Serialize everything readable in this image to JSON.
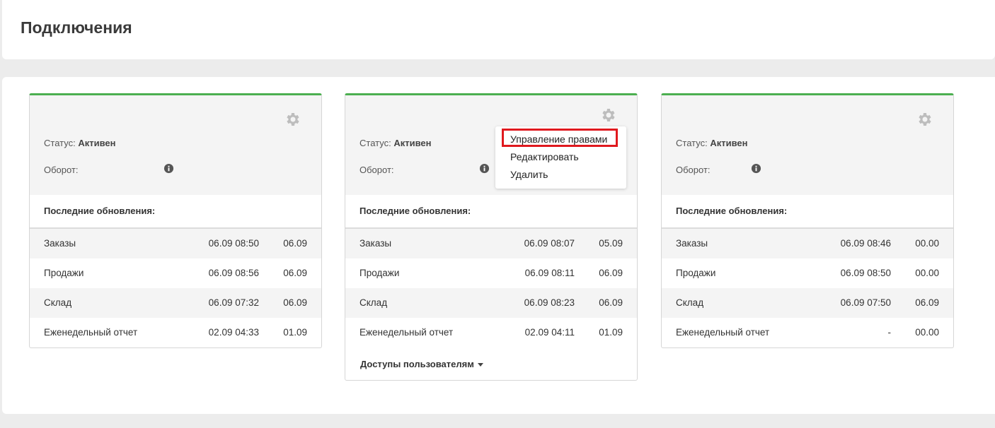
{
  "page": {
    "title": "Подключения"
  },
  "labels": {
    "status_prefix": "Статус:",
    "turnover": "Оборот:",
    "updates_title": "Последние обновления:"
  },
  "cards": [
    {
      "status": "Активен",
      "rows": [
        {
          "name": "Заказы",
          "date1": "06.09 08:50",
          "date2": "06.09"
        },
        {
          "name": "Продажи",
          "date1": "06.09 08:56",
          "date2": "06.09"
        },
        {
          "name": "Склад",
          "date1": "06.09 07:32",
          "date2": "06.09"
        },
        {
          "name": "Еженедельный отчет",
          "date1": "02.09 04:33",
          "date2": "01.09"
        }
      ]
    },
    {
      "status": "Активен",
      "rows": [
        {
          "name": "Заказы",
          "date1": "06.09 08:07",
          "date2": "05.09"
        },
        {
          "name": "Продажи",
          "date1": "06.09 08:11",
          "date2": "06.09"
        },
        {
          "name": "Склад",
          "date1": "06.09 08:23",
          "date2": "06.09"
        },
        {
          "name": "Еженедельный отчет",
          "date1": "02.09 04:11",
          "date2": "01.09"
        }
      ],
      "access_label": "Доступы пользователям"
    },
    {
      "status": "Активен",
      "rows": [
        {
          "name": "Заказы",
          "date1": "06.09 08:46",
          "date2": "00.00"
        },
        {
          "name": "Продажи",
          "date1": "06.09 08:50",
          "date2": "00.00"
        },
        {
          "name": "Склад",
          "date1": "06.09 07:50",
          "date2": "06.09"
        },
        {
          "name": "Еженедельный отчет",
          "date1": "-",
          "date2": "00.00"
        }
      ]
    }
  ],
  "dropdown": {
    "items": [
      "Управление правами",
      "Редактировать",
      "Удалить"
    ]
  },
  "colors": {
    "accent_green": "#4caf50",
    "highlight_red": "#e0191e",
    "icon_gray": "#bdbdbd"
  },
  "icons": {
    "settings": "gear-icon",
    "info": "info-icon",
    "caret": "caret-down-icon"
  }
}
